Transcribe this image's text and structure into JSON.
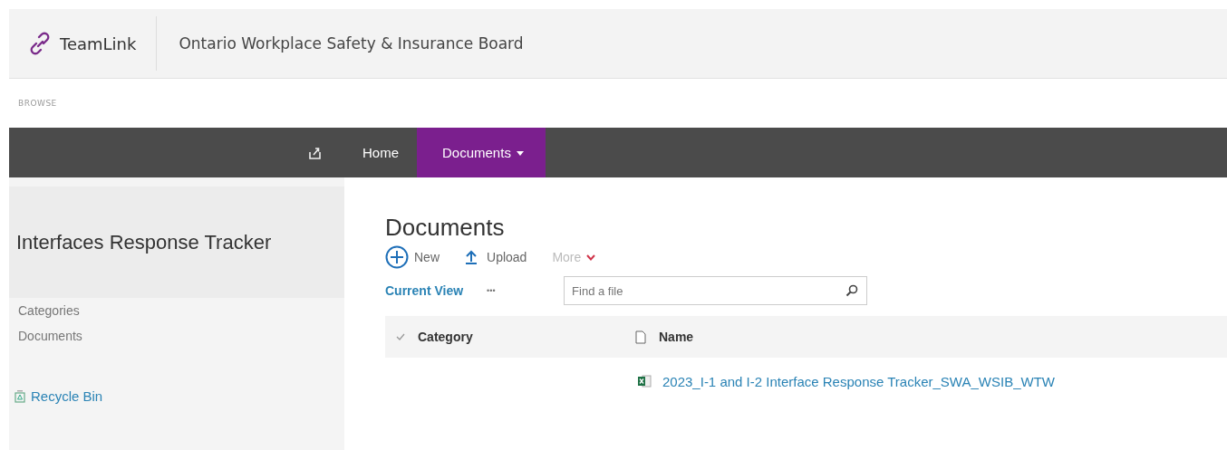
{
  "header": {
    "brand": "TeamLink",
    "site_title": "Ontario Workplace Safety & Insurance Board"
  },
  "ribbon": {
    "tab": "BROWSE"
  },
  "nav": {
    "tabs": [
      {
        "label": "Home",
        "selected": false,
        "dropdown": false
      },
      {
        "label": "Documents",
        "selected": true,
        "dropdown": true
      }
    ]
  },
  "sidebar": {
    "title": "Interfaces Response Tracker",
    "items": [
      {
        "label": "Categories"
      },
      {
        "label": "Documents"
      }
    ],
    "recycle_bin": "Recycle Bin"
  },
  "main": {
    "title": "Documents",
    "commands": [
      {
        "kind": "new",
        "label": "New",
        "disabled": false
      },
      {
        "kind": "upload",
        "label": "Upload",
        "disabled": false
      },
      {
        "kind": "more",
        "label": "More",
        "disabled": true
      }
    ],
    "view": "Current View",
    "view_more": "•••",
    "search": {
      "placeholder": "Find a file"
    },
    "table": {
      "columns": [
        {
          "kind": "check",
          "label": "Category"
        },
        {
          "kind": "file",
          "label": "Name"
        }
      ],
      "rows": [
        {
          "category": "",
          "name": "2023_I-1 and I-2 Interface Response Tracker_SWA_WSIB_WTW"
        }
      ]
    }
  }
}
